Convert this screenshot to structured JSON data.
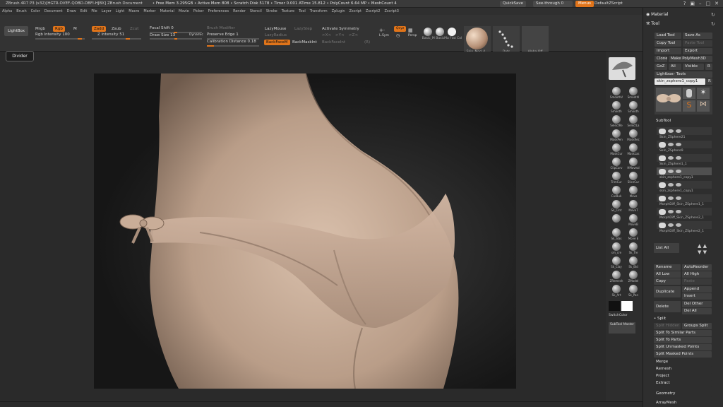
{
  "titlebar": {
    "app": "ZBrush 4R7 P3 (x32)[HGTR-OVEF-QOBD-DBFI-HJBX]   ZBrush Document",
    "free_mem": "• Free Mem 3.295GB • Active Mem 808 • Scratch Disk 5178 • Timer 0.001 ATime 15.812 • PolyCount 6.64 MP • MeshCount 4",
    "quicksave": "QuickSave",
    "seethrough": "See-through  0",
    "menus": "Menus",
    "default_zscript": "DefaultZScript"
  },
  "menubar": [
    "Alpha",
    "Brush",
    "Color",
    "Document",
    "Draw",
    "Edit",
    "File",
    "Layer",
    "Light",
    "Macro",
    "Marker",
    "Material",
    "Movie",
    "Picker",
    "Preferences",
    "Render",
    "Stencil",
    "Stroke",
    "Texture",
    "Tool",
    "Transform",
    "Zplugin",
    "Zscript",
    "Zscript2",
    "Zscript3"
  ],
  "shelf": {
    "lightbox": "LightBox",
    "mrgb": "Mrgb",
    "rgb": "Rgb",
    "m": "M",
    "zadd": "Zadd",
    "zsub": "Zsub",
    "zcut": "Zcut",
    "rgb_intensity": "Rgb  Intensity 100",
    "z_intensity": "Z Intensity 51",
    "focal_shift": "Focal Shift 0",
    "draw_size": "Draw Size 13",
    "dynamic": "Dynamic",
    "brush_modifier": "Brush Modifier",
    "preserve_edge": "Preserve Edge 1",
    "calibration_distance": "Calibration Distance 0.18",
    "backface": "BackFaceM",
    "backmask_int": "BackMaskInt",
    "backface_int": "BackFaceInt",
    "lazymouse": "LazyMouse",
    "lazystep": "LazyStep",
    "lazyradius": "LazyRadius",
    "activate_symmetry": "Activate Symmetry",
    "sym_x": ">X<",
    "sym_y": ">Y<",
    "sym_z": ">Z<",
    "sym_r": "(R)",
    "lsym": "L.Sym",
    "persp": "Persp",
    "material_labels": [
      "Basic_M",
      "BasicMa",
      "Flat",
      "Col"
    ],
    "mat_mid": "Skin_Mod_4...",
    "dots_lbl": "Dots",
    "alpha_lbl": "Alpha Off"
  },
  "divider_tooltip": "Divider",
  "toolcol": [
    {
      "label": "SmoothV",
      "label2": "SmoothI"
    },
    {
      "label": "Smooth",
      "label2": "Smooth"
    },
    {
      "label": "SelectRe",
      "label2": "SelectLa"
    },
    {
      "label": "MaskPen",
      "label2": "MaskRec"
    },
    {
      "label": "MaskCur",
      "label2": "MaskLas"
    },
    {
      "label": "ClipCurv",
      "label2": "HMoveal"
    },
    {
      "label": "TrimCur",
      "label2": "SliceCur"
    },
    {
      "label": "CurBuk",
      "label2": "Move"
    },
    {
      "label": "Sk_Clnt",
      "label2": "MoveT"
    },
    {
      "label": "",
      "label2": "MoveB"
    },
    {
      "label": "Sk_Slas",
      "label2": "Move E"
    },
    {
      "label": "sm_cre",
      "label2": "Sk_Tre"
    },
    {
      "label": "Sk_Clay",
      "label2": "Sk_Bld"
    },
    {
      "label": "ZRemesh",
      "label2": "ZModel"
    },
    {
      "label": "Sk_Art",
      "label2": "Sk_Pan"
    }
  ],
  "switch_color": "SwitchColor",
  "subtool_master": "SubTool Master",
  "rightpanel": {
    "material": "Material",
    "tool": "Tool",
    "load_tool": "Load Tool",
    "save_as": "Save As",
    "copy_tool": "Copy Tool",
    "paste_tool": "Paste Tool",
    "import": "Import",
    "export": "Export",
    "clone": "Clone",
    "make_polymesh": "Make PolyMesh3D",
    "goz": "GoZ",
    "all": "All",
    "visible": "Visible",
    "r": "R",
    "lightbox_tools": "Lightbox› Tools",
    "current_tool": "skin_zsphere1_copy1",
    "r2": "R",
    "tool_thumbs": [
      "skin_zsphere1",
      "Cylinder",
      "PolyMes",
      "SimpleB",
      "skin_zs"
    ],
    "subtool": "SubTool",
    "subtools": [
      "Skin_ZSphere21",
      "Skin_ZSphere9",
      "Skin_ZSphere1_1",
      "skin_zsphere1_copy1",
      "skin_zsphere1_copy1",
      "MorphDiff_Skin_ZSphere1_1",
      "MorphDiff_Skin_ZSphere2_1",
      "MorphDiff_Skin_ZSphere2_1"
    ],
    "list_all": "List All",
    "rename": "Rename",
    "autoreorder": "AutoReorder",
    "all_low": "All Low",
    "all_high": "All High",
    "copy": "Copy",
    "paste": "Paste",
    "duplicate": "Duplicate",
    "append": "Append",
    "insert": "Insert",
    "delete": "Delete",
    "del_other": "Del Other",
    "del_all": "Del All",
    "split": "Split",
    "split_hidden": "Split Hidden",
    "groups_split": "Groups Split",
    "split_similar": "Split To Similar Parts",
    "split_parts": "Split To Parts",
    "split_unmasked": "Split Unmasked Points",
    "split_masked": "Split Masked Points",
    "merge": "Merge",
    "remesh": "Remesh",
    "project": "Project",
    "extract": "Extract",
    "geometry": "Geometry",
    "arraymesh": "ArrayMesh"
  },
  "colors": {
    "accent": "#e0741a",
    "skin": "#c9ad98"
  }
}
